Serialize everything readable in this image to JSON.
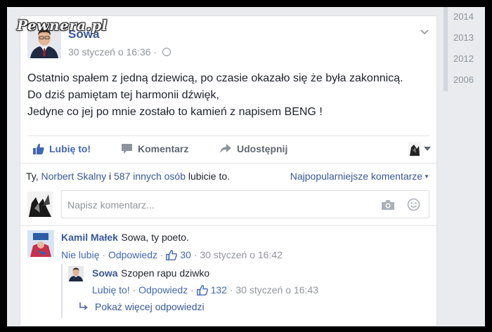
{
  "watermark": "Pewnera.pl",
  "timeline_years": [
    "2014",
    "2013",
    "2012",
    "2006"
  ],
  "post": {
    "author": "Sowa",
    "timestamp": "30 styczeń o 16:36 ·",
    "lines": [
      "Ostatnio spałem z jedną dziewicą, po czasie okazało się że była zakonnicą.",
      "Do dziś pamiętam tej harmonii dźwięk,",
      "Jedyne co jej po mnie zostało to kamień z napisem BENG !"
    ]
  },
  "actions": {
    "like": "Lubię to!",
    "comment": "Komentarz",
    "share": "Udostępnij"
  },
  "likes": {
    "prefix": "Ty, ",
    "name": "Norbert Skalny",
    "middle": " i ",
    "others": "587 innych osób",
    "suffix": " lubicie to."
  },
  "sort_label": "Najpopularniejsze komentarze",
  "comment_input": {
    "placeholder": "Napisz komentarz..."
  },
  "comments": [
    {
      "name": "Kamil Małek",
      "text": "Sowa, ty poeto.",
      "action1": "Nie lubię",
      "action2": "Odpowiedz",
      "likes": "30",
      "time": "30 styczeń o 16:42"
    }
  ],
  "reply": {
    "name": "Sowa",
    "text": "Szopen rapu dziwko",
    "action1": "Lubię to!",
    "action2": "Odpowiedz",
    "likes": "132",
    "time": "30 styczeń o 16:43"
  },
  "more_replies": "Pokaż więcej odpowiedzi",
  "colors": {
    "link": "#365899",
    "like": "#4267b2",
    "muted": "#90949c",
    "bg": "#e9ebee"
  }
}
